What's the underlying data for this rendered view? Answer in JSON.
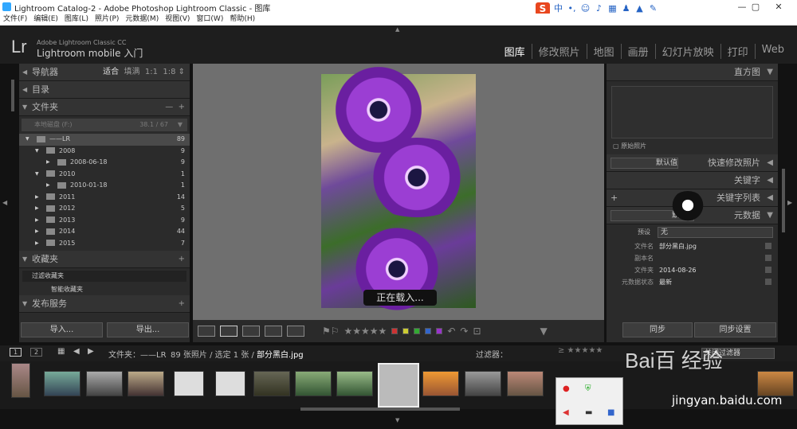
{
  "window": {
    "title": "Lightroom Catalog-2 - Adobe Photoshop Lightroom Classic - 图库"
  },
  "menu": [
    "文件(F)",
    "编辑(E)",
    "图库(L)",
    "照片(P)",
    "元数据(M)",
    "视图(V)",
    "窗口(W)",
    "帮助(H)"
  ],
  "ime": {
    "logo": "S",
    "lang": "中"
  },
  "identity": {
    "logo": "Lr",
    "sub": "Adobe Lightroom Classic CC",
    "main": "Lightroom mobile 入门"
  },
  "modules": [
    "图库",
    "修改照片",
    "地图",
    "画册",
    "幻灯片放映",
    "打印",
    "Web"
  ],
  "left": {
    "navigator": {
      "title": "导航器",
      "opts": [
        "适合",
        "填满",
        "1:1",
        "1:8"
      ]
    },
    "catalog": {
      "title": "目录"
    },
    "folders": {
      "title": "文件夹",
      "filter": "本地磁盘 (F:)",
      "disk": "38.1 / 67",
      "items": [
        {
          "name": "——LR",
          "count": "89",
          "lvl": 0
        },
        {
          "name": "2008",
          "count": "9",
          "lvl": 1
        },
        {
          "name": "2008-06-18",
          "count": "9",
          "lvl": 2
        },
        {
          "name": "2010",
          "count": "1",
          "lvl": 1
        },
        {
          "name": "2010-01-18",
          "count": "1",
          "lvl": 2
        },
        {
          "name": "2011",
          "count": "14",
          "lvl": 1
        },
        {
          "name": "2012",
          "count": "5",
          "lvl": 1
        },
        {
          "name": "2013",
          "count": "9",
          "lvl": 1
        },
        {
          "name": "2014",
          "count": "44",
          "lvl": 1
        },
        {
          "name": "2015",
          "count": "7",
          "lvl": 1
        }
      ]
    },
    "collections": {
      "title": "收藏夹",
      "filter": "过滤收藏夹",
      "smart": "智能收藏夹"
    },
    "publish": {
      "title": "发布服务"
    },
    "import": "导入...",
    "export": "导出..."
  },
  "center": {
    "loading": "正在载入..."
  },
  "right": {
    "histogram": {
      "title": "直方图",
      "original": "原始照片"
    },
    "quick": {
      "preset": "默认值",
      "title": "快速修改照片"
    },
    "keyword": {
      "title": "关键字"
    },
    "keywordlist": {
      "title": "关键字列表"
    },
    "metadata": {
      "preset": "默认值",
      "title": "元数据",
      "preset_label": "预设",
      "preset_value": "无",
      "rows": [
        [
          "文件名",
          "部分黑白.jpg"
        ],
        [
          "副本名",
          ""
        ],
        [
          "文件夹",
          "2014-08-26"
        ],
        [
          "元数据状态",
          "最新"
        ]
      ]
    },
    "sync": "同步",
    "syncsettings": "同步设置"
  },
  "filmstrip": {
    "page1": "1",
    "page2": "2",
    "source": "文件夹：——LR",
    "count": "89 张照片 / 选定 1 张 /",
    "file": "部分黑白.jpg",
    "filter": "过滤器：",
    "filteroff": "关闭过滤器"
  },
  "watermark": {
    "baidu": "Bai百 经验",
    "url": "jingyan.baidu.com"
  },
  "colors": {
    "bg": "#121212",
    "panel": "#2b2b2b",
    "center": "#6f6f6f"
  }
}
